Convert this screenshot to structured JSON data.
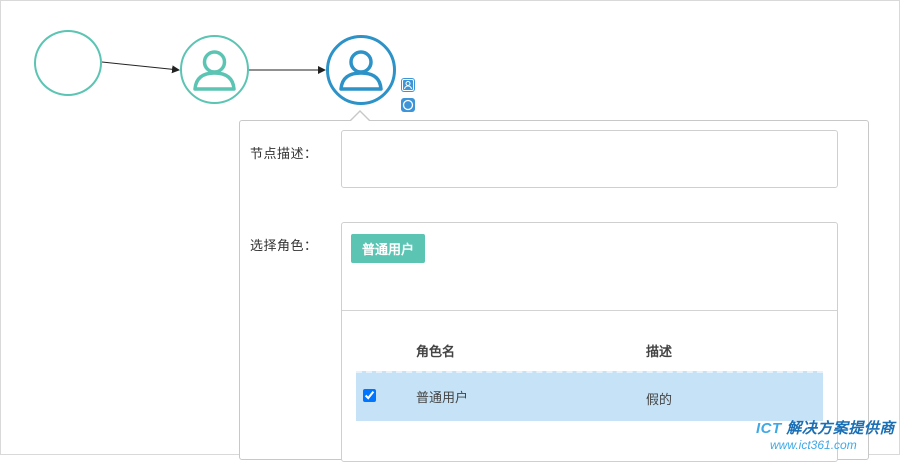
{
  "form": {
    "node_description_label": "节点描述：",
    "node_description_value": "",
    "select_role_label": "选择角色：",
    "selected_role_tag": "普通用户"
  },
  "role_table": {
    "columns": [
      "角色名",
      "描述"
    ],
    "rows": [
      {
        "name": "普通用户",
        "description": "假的",
        "checked": true
      }
    ]
  },
  "watermark": {
    "prefix": "ICT",
    "text": "解决方案提供商",
    "url": "www.ict361.com"
  },
  "colors": {
    "teal": "#5bc4b3",
    "blue": "#2c92c7",
    "button_blue": "#3d95d8",
    "row_highlight": "#c6e2f6"
  },
  "icons": {
    "start_node": "circle-node-icon",
    "user_node": "user-icon",
    "mini_user": "user-icon",
    "mini_circle": "circle-icon"
  }
}
